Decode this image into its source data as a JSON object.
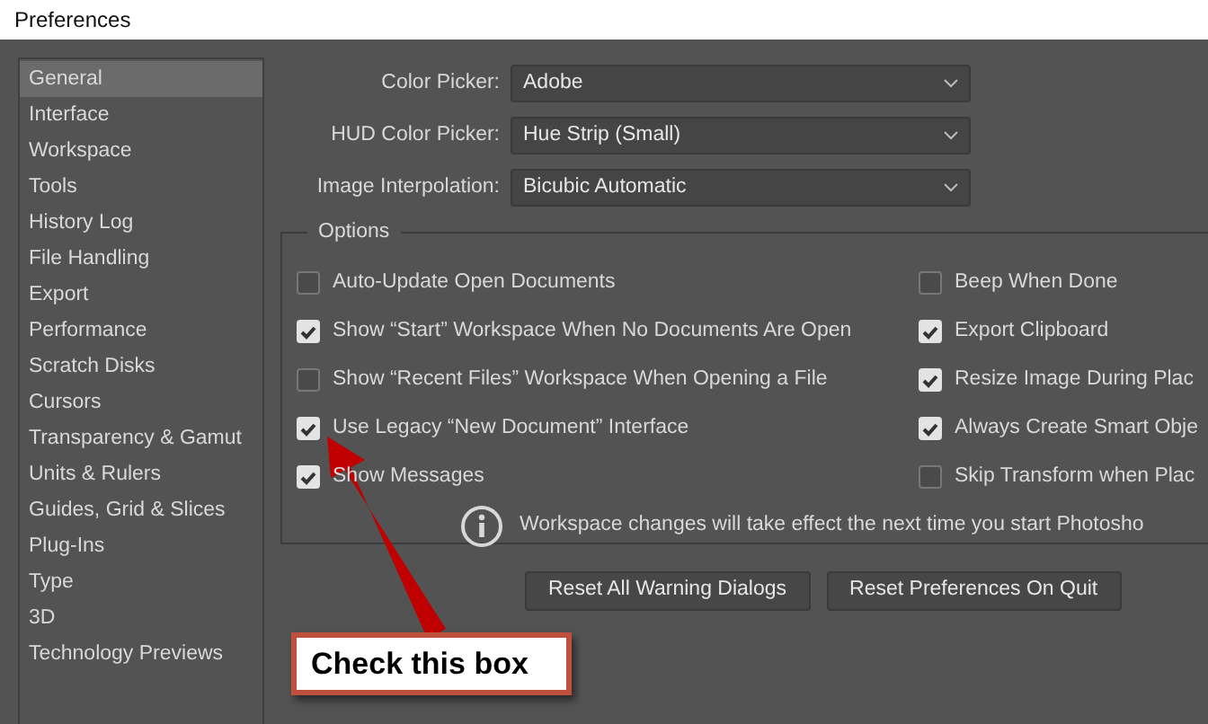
{
  "window": {
    "title": "Preferences"
  },
  "sidebar": {
    "items": [
      {
        "label": "General",
        "selected": true
      },
      {
        "label": "Interface",
        "selected": false
      },
      {
        "label": "Workspace",
        "selected": false
      },
      {
        "label": "Tools",
        "selected": false
      },
      {
        "label": "History Log",
        "selected": false
      },
      {
        "label": "File Handling",
        "selected": false
      },
      {
        "label": "Export",
        "selected": false
      },
      {
        "label": "Performance",
        "selected": false
      },
      {
        "label": "Scratch Disks",
        "selected": false
      },
      {
        "label": "Cursors",
        "selected": false
      },
      {
        "label": "Transparency & Gamut",
        "selected": false
      },
      {
        "label": "Units & Rulers",
        "selected": false
      },
      {
        "label": "Guides, Grid & Slices",
        "selected": false
      },
      {
        "label": "Plug-Ins",
        "selected": false
      },
      {
        "label": "Type",
        "selected": false
      },
      {
        "label": "3D",
        "selected": false
      },
      {
        "label": "Technology Previews",
        "selected": false
      }
    ]
  },
  "dropdowns": [
    {
      "label": "Color Picker:",
      "value": "Adobe"
    },
    {
      "label": "HUD Color Picker:",
      "value": "Hue Strip (Small)"
    },
    {
      "label": "Image Interpolation:",
      "value": "Bicubic Automatic"
    }
  ],
  "options": {
    "title": "Options",
    "columns": [
      [
        {
          "label": "Auto-Update Open Documents",
          "checked": false
        },
        {
          "label": "Show “Start” Workspace When No Documents Are Open",
          "checked": true
        },
        {
          "label": "Show “Recent Files” Workspace When Opening a File",
          "checked": false
        },
        {
          "label": "Use Legacy “New Document” Interface",
          "checked": true
        },
        {
          "label": "Show Messages",
          "checked": true
        }
      ],
      [
        {
          "label": "Beep When Done",
          "checked": false
        },
        {
          "label": "Export Clipboard",
          "checked": true
        },
        {
          "label": "Resize Image During Plac",
          "checked": true
        },
        {
          "label": "Always Create Smart Obje",
          "checked": true
        },
        {
          "label": "Skip Transform when Plac",
          "checked": false
        }
      ]
    ],
    "note": "Workspace changes will take effect the next time you start Photosho"
  },
  "buttons": [
    "Reset All Warning Dialogs",
    "Reset Preferences On Quit"
  ],
  "annotation": {
    "text": "Check this box"
  }
}
